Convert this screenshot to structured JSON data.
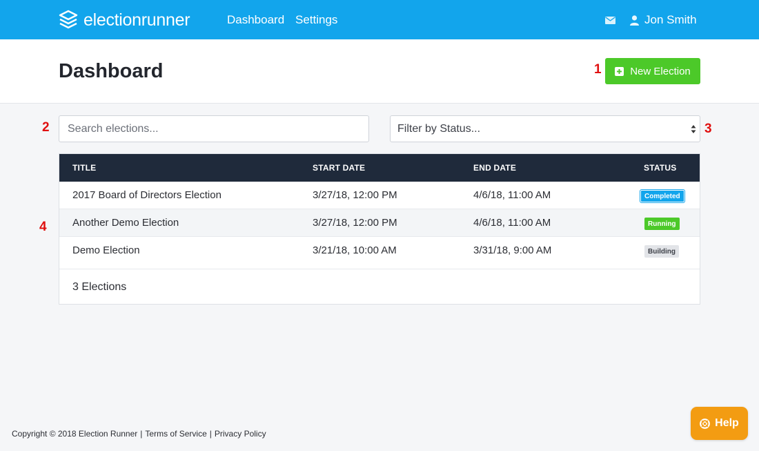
{
  "brand": {
    "logo_light": "election",
    "logo_bold": "runner",
    "color": "#12a5ec"
  },
  "nav": {
    "dashboard": "Dashboard",
    "settings": "Settings"
  },
  "user": {
    "name": "Jon Smith",
    "mail_icon": "mail-icon",
    "user_icon": "user-icon"
  },
  "header": {
    "title": "Dashboard",
    "new_button": "New Election"
  },
  "annotations": {
    "a1": "1",
    "a2": "2",
    "a3": "3",
    "a4": "4"
  },
  "filters": {
    "search_placeholder": "Search elections...",
    "status_select": "Filter by Status..."
  },
  "table": {
    "headers": {
      "title": "TITLE",
      "start": "START DATE",
      "end": "END DATE",
      "status": "STATUS"
    },
    "rows": [
      {
        "title": "2017 Board of Directors Election",
        "start": "3/27/18, 12:00 PM",
        "end": "4/6/18, 11:00 AM",
        "status": "Completed"
      },
      {
        "title": "Another Demo Election",
        "start": "3/27/18, 12:00 PM",
        "end": "4/6/18, 11:00 AM",
        "status": "Running"
      },
      {
        "title": "Demo Election",
        "start": "3/21/18, 10:00 AM",
        "end": "3/31/18, 9:00 AM",
        "status": "Building"
      }
    ],
    "footer": "3 Elections"
  },
  "footer": {
    "copyright": "Copyright © 2018 Election Runner",
    "sep": "|",
    "terms": "Terms of Service",
    "privacy": "Privacy Policy"
  },
  "help": {
    "label": "Help",
    "color": "#f39c12"
  }
}
